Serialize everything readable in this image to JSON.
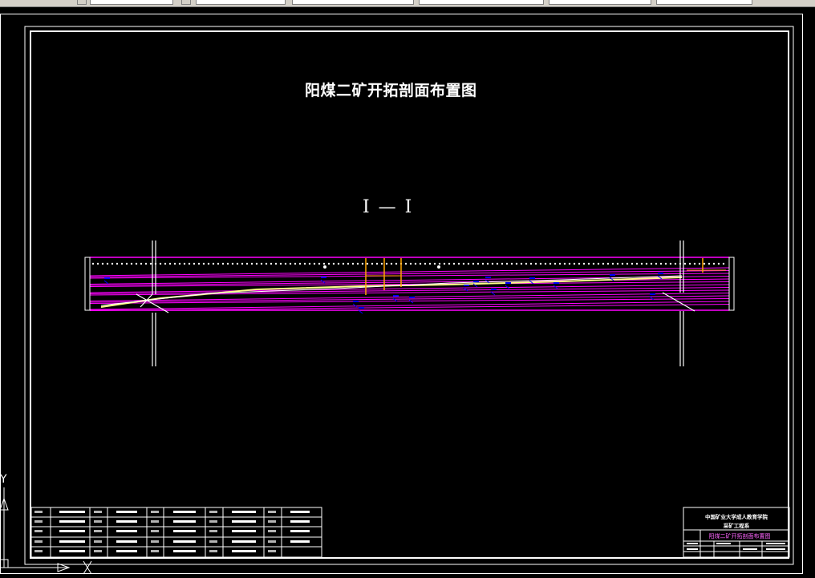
{
  "drawing": {
    "title": "阳煤二矿开拓剖面布置图",
    "section_label": "Ⅰ — Ⅰ"
  },
  "title_block": {
    "org_line1": "中国矿业大学成人教育学院",
    "org_line2": "采矿工程系",
    "drawing_name": "阳煤二矿开拓剖面布置图"
  },
  "ucs_icon": {
    "x_label": "X",
    "y_label": "Y"
  },
  "colors": {
    "background": "#000000",
    "frame": "#ffffff",
    "strata": "#ff00ff",
    "workings": "#ffa500",
    "annotations": "#0000ff",
    "coal_seam": "#ffff88"
  }
}
